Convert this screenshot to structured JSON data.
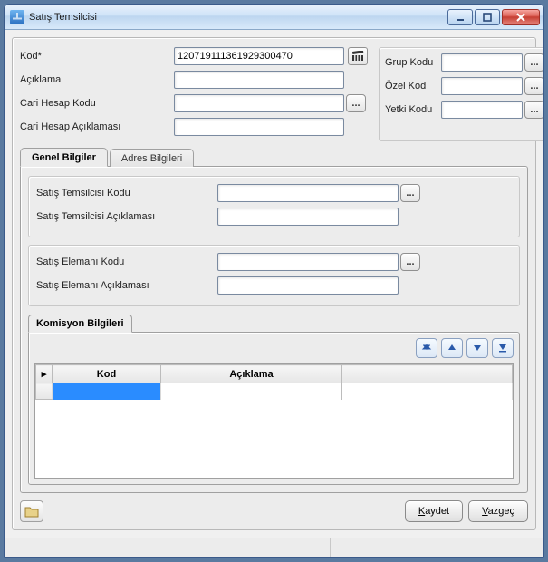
{
  "window": {
    "title": "Satış Temsilcisi"
  },
  "top": {
    "kod_label": "Kod*",
    "kod_value": "120719111361929300470",
    "aciklama_label": "Açıklama",
    "aciklama_value": "",
    "cari_hesap_kodu_label": "Cari Hesap Kodu",
    "cari_hesap_kodu_value": "",
    "cari_hesap_aciklamasi_label": "Cari Hesap Açıklaması",
    "cari_hesap_aciklamasi_value": ""
  },
  "right": {
    "grup_kodu_label": "Grup Kodu",
    "grup_kodu_value": "",
    "ozel_kod_label": "Özel Kod",
    "ozel_kod_value": "",
    "yetki_kodu_label": "Yetki Kodu",
    "yetki_kodu_value": ""
  },
  "tabs": {
    "genel": "Genel Bilgiler",
    "adres": "Adres Bilgileri"
  },
  "group1": {
    "kodu_label": "Satış Temsilcisi Kodu",
    "kodu_value": "",
    "aciklama_label": "Satış Temsilcisi Açıklaması",
    "aciklama_value": ""
  },
  "group2": {
    "kodu_label": "Satış Elemanı Kodu",
    "kodu_value": "",
    "aciklama_label": "Satış Elemanı Açıklaması",
    "aciklama_value": ""
  },
  "komisyon": {
    "title": "Komisyon Bilgileri",
    "col_kod": "Kod",
    "col_aciklama": "Açıklama"
  },
  "footer": {
    "kaydet_rest": "aydet",
    "vazgec_rest": "azgeç"
  },
  "icons": {
    "ellipsis": "...",
    "movie": "movie-icon",
    "first": "go-first-icon",
    "prev": "go-prev-icon",
    "next": "go-next-icon",
    "last": "go-last-icon",
    "folder": "folder-icon"
  }
}
